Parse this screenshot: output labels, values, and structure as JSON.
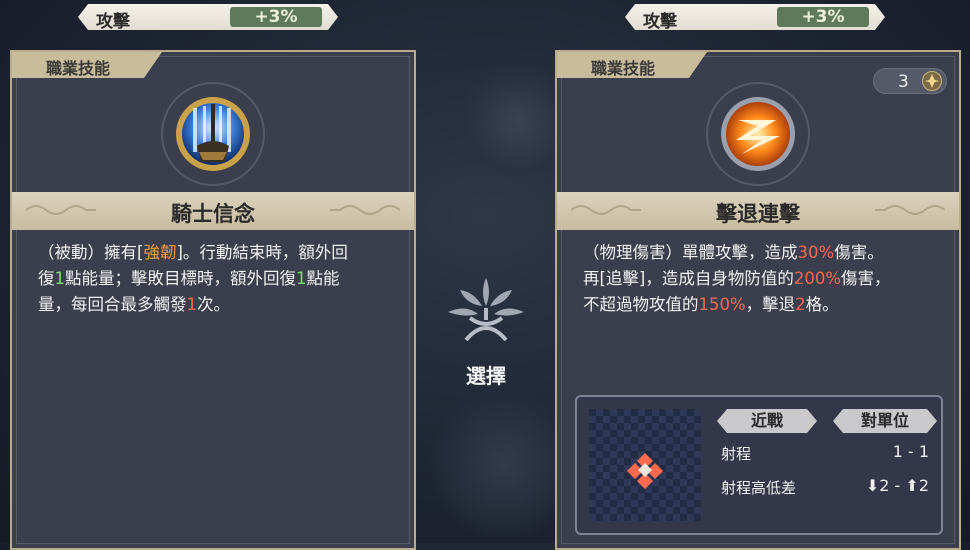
{
  "left": {
    "stat": {
      "name": "攻擊",
      "value": "+3%"
    },
    "tag": "職業技能",
    "skill_name": "騎士信念",
    "desc": [
      [
        {
          "t": "（被動）擁有["
        },
        {
          "t": "強韌",
          "c": "o"
        },
        {
          "t": "]。行動結束時，額外回"
        }
      ],
      [
        {
          "t": "復"
        },
        {
          "t": "1",
          "c": "g"
        },
        {
          "t": "點能量；擊敗目標時，額外回復"
        },
        {
          "t": "1",
          "c": "g"
        },
        {
          "t": "點能"
        }
      ],
      [
        {
          "t": "量，每回合最多觸發"
        },
        {
          "t": "1",
          "c": "r"
        },
        {
          "t": "次。"
        }
      ]
    ]
  },
  "right": {
    "stat": {
      "name": "攻擊",
      "value": "+3%"
    },
    "tag": "職業技能",
    "cost": "3",
    "skill_name": "擊退連擊",
    "desc": [
      [
        {
          "t": "（物理傷害）單體攻擊，造成"
        },
        {
          "t": "30%",
          "c": "r"
        },
        {
          "t": "傷害。"
        }
      ],
      [
        {
          "t": "再[追擊]，造成自身物防值的"
        },
        {
          "t": "200%",
          "c": "r"
        },
        {
          "t": "傷害，"
        }
      ],
      [
        {
          "t": "不超過物攻值的"
        },
        {
          "t": "150%",
          "c": "r"
        },
        {
          "t": "，擊退"
        },
        {
          "t": "2",
          "c": "r"
        },
        {
          "t": "格。"
        }
      ]
    ],
    "range": {
      "type": "近戰",
      "target": "對單位",
      "range_label": "射程",
      "range_value": "1 - 1",
      "height_label": "射程高低差",
      "height_value": "⬇2 - ⬆2"
    }
  },
  "center": {
    "label": "選擇"
  },
  "colors": {
    "accent": "#c8bc9a",
    "highlight_orange": "#ff9a3a",
    "highlight_green": "#7be06b",
    "highlight_red": "#ff6a4c"
  },
  "icons": {
    "left_skill": "knight-faith-icon",
    "right_skill": "knockback-combo-icon",
    "cost": "energy-diamond-icon",
    "center": "tree-emblem-icon"
  }
}
